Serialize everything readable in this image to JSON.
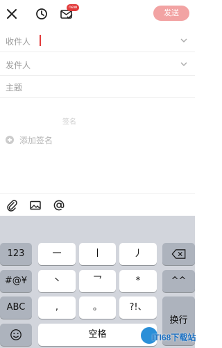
{
  "toolbar": {
    "badge": "new",
    "send_label": "发送"
  },
  "form": {
    "recipient_label": "收件人",
    "sender_label": "发件人",
    "subject_label": "主题"
  },
  "signature": {
    "title": "签名",
    "add_label": "添加签名"
  },
  "keyboard": {
    "row1": {
      "left": "123",
      "keys": [
        "一",
        "丨",
        "丿"
      ]
    },
    "row2": {
      "left": "#@¥",
      "keys": [
        "丶",
        "乛",
        "*"
      ],
      "right": "^^"
    },
    "row3": {
      "left": "ABC",
      "keys": [
        ",",
        "。",
        "?!、"
      ]
    },
    "row4": {
      "space": "空格",
      "return": "换行"
    }
  },
  "watermark": {
    "text": "ITI68下载站"
  },
  "colors": {
    "accent": "#e23a3a",
    "send_button": "#f2a3a3"
  }
}
